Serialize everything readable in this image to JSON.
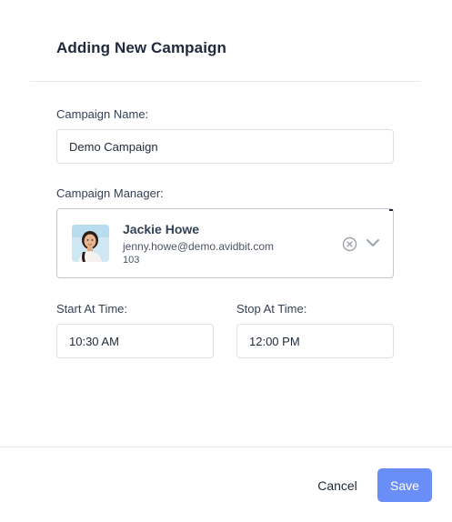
{
  "modal": {
    "title": "Adding New Campaign"
  },
  "form": {
    "campaign_name_label": "Campaign Name:",
    "campaign_name_value": "Demo Campaign",
    "campaign_manager_label": "Campaign Manager:",
    "manager": {
      "name": "Jackie Howe",
      "email": "jenny.howe@demo.avidbit.com",
      "extension": "103",
      "avatar_icon": "user-avatar-photo",
      "clear_icon": "clear-circle-x-icon",
      "dropdown_icon": "chevron-down-icon"
    },
    "start_label": "Start At Time:",
    "start_value": "10:30 AM",
    "stop_label": "Stop At Time:",
    "stop_value": "12:00 PM"
  },
  "footer": {
    "cancel_label": "Cancel",
    "save_label": "Save"
  },
  "colors": {
    "accent": "#6a8ef7",
    "border": "#dcdfe4",
    "title": "#1e293b"
  }
}
